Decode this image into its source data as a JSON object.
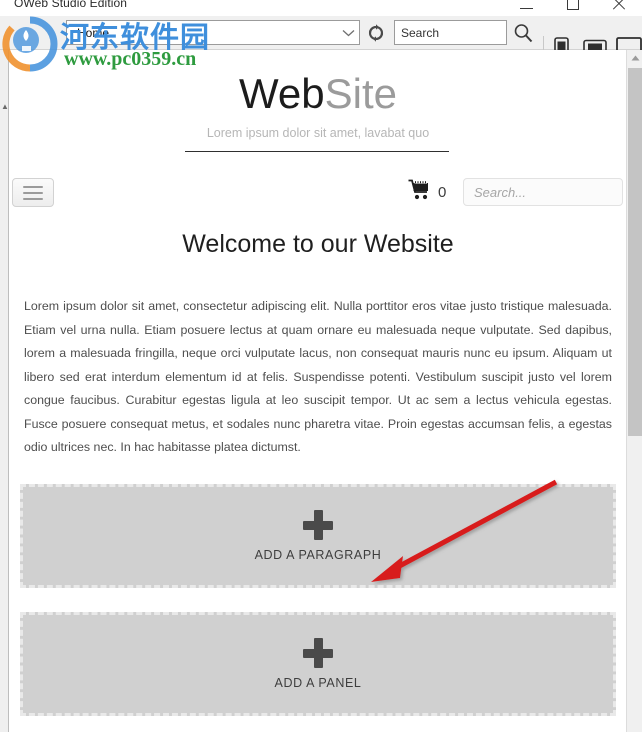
{
  "window": {
    "title": "OWeb Studio Edition",
    "minimize_label": "Minimize",
    "maximize_label": "Maximize",
    "close_label": "Close"
  },
  "toolbar": {
    "page_selector_value": "Home",
    "page_selector_icon": "page-icon",
    "dropdown_icon": "chevron-down-icon",
    "refresh_icon": "refresh-icon",
    "search_value": "Search",
    "search_placeholder": "Search",
    "search_button_icon": "magnifier-icon",
    "devices": [
      {
        "name": "phone-preview",
        "icon": "phone-icon",
        "label": "Phone"
      },
      {
        "name": "tablet-preview",
        "icon": "tablet-icon",
        "label": "Tablet"
      },
      {
        "name": "desktop-preview",
        "icon": "desktop-icon",
        "label": "Desktop"
      }
    ]
  },
  "site": {
    "title_dark": "Web",
    "title_light": "Site",
    "tagline": "Lorem ipsum dolor sit amet, lavabat quo",
    "menu_icon": "hamburger-icon",
    "cart_icon": "shopping-cart-icon",
    "cart_count": "0",
    "search_placeholder": "Search...",
    "search_value": "",
    "search_icon": "magnifier-icon",
    "heading": "Welcome to our Website",
    "paragraph": "Lorem ipsum dolor sit amet, consectetur adipiscing elit. Nulla porttitor eros vitae justo tristique malesuada. Etiam vel urna nulla. Etiam posuere lectus at quam ornare eu malesuada neque vulputate. Sed dapibus, lorem a malesuada fringilla, neque orci vulputate lacus, non consequat mauris nunc eu ipsum. Aliquam ut libero sed erat interdum elementum id at felis. Suspendisse potenti. Vestibulum suscipit justo vel lorem congue faucibus. Curabitur egestas ligula at leo suscipit tempor. Ut ac sem a lectus vehicula egestas. Fusce posuere consequat metus, et sodales nunc pharetra vitae. Proin egestas accumsan felis, a egestas odio ultrices nec. In hac habitasse platea dictumst."
  },
  "dropzones": [
    {
      "name": "add-paragraph",
      "label": "ADD A PARAGRAPH",
      "icon": "plus-icon"
    },
    {
      "name": "add-panel",
      "label": "ADD A PANEL",
      "icon": "plus-icon"
    }
  ],
  "scrollbar": {
    "up_arrow_icon": "triangle-up-icon"
  },
  "watermark": {
    "site_name_cn": "河东软件园",
    "site_url": "www.pc0359.cn",
    "logo_icon": "watermark-logo-icon",
    "color_cn": "#3f8fdc",
    "color_url": "#2e9b3f"
  },
  "annotation": {
    "arrow_color": "#d81f1f",
    "name": "red-pointer-arrow"
  },
  "colors": {
    "toolbar_bg": "#f0f0f0",
    "canvas_bg": "#ffffff",
    "dropzone_bg": "#d0d0d0",
    "dropzone_border": "#e9e9e9",
    "title_dark": "#1c1c1c",
    "title_light": "#9b9b9b"
  }
}
